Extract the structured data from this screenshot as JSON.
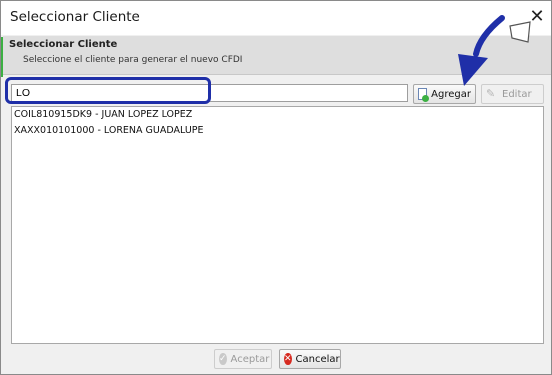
{
  "window": {
    "title": "Seleccionar Cliente",
    "close_icon": "close-icon"
  },
  "header": {
    "title": "Seleccionar Cliente",
    "subtitle": "Seleccione el cliente para generar el nuevo CFDI"
  },
  "search": {
    "value": "LO"
  },
  "toolbar": {
    "agregar_label": "Agregar",
    "agregar_icon": "add-client-icon",
    "editar_label": "Editar",
    "editar_icon": "edit-icon"
  },
  "clients": [
    "COIL810915DK9 - JUAN LOPEZ LOPEZ",
    "XAXX010101000 - LORENA GUADALUPE"
  ],
  "footer": {
    "aceptar_label": "Aceptar",
    "aceptar_icon": "check-icon",
    "cancelar_label": "Cancelar",
    "cancelar_icon": "cancel-icon"
  },
  "annotation": {
    "highlight_color": "#1f2fa8",
    "arrow_icon": "pointer-arrow-icon"
  }
}
